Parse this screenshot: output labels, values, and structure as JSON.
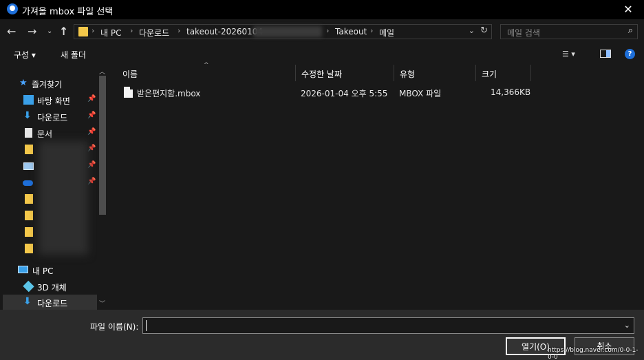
{
  "window": {
    "title": "가져올 mbox 파일 선택",
    "close_icon": "close-icon"
  },
  "nav": {
    "back_icon": "back-arrow-icon",
    "forward_icon": "forward-arrow-icon",
    "recent_icon": "chevron-down-icon",
    "up_icon": "up-arrow-icon",
    "address": {
      "crumbs": [
        "내 PC",
        "다운로드",
        "takeout-20260104",
        "Takeout",
        "메일"
      ]
    },
    "search": {
      "placeholder": "메일 검색"
    }
  },
  "toolbar": {
    "organize_label": "구성 ▾",
    "new_folder_label": "새 폴더"
  },
  "sidebar": {
    "quick_access_label": "즐겨찾기",
    "items": [
      {
        "label": "바탕 화면",
        "icon": "desktop-icon",
        "pinned": true
      },
      {
        "label": "다운로드",
        "icon": "download-icon",
        "pinned": true
      },
      {
        "label": "문서",
        "icon": "document-icon",
        "pinned": true
      }
    ],
    "this_pc_label": "내 PC",
    "pc_items": [
      {
        "label": "3D 개체",
        "icon": "3d-objects-icon"
      },
      {
        "label": "다운로드",
        "icon": "download-icon",
        "selected": true
      }
    ]
  },
  "columns": {
    "name": "이름",
    "modified": "수정한 날짜",
    "type": "유형",
    "size": "크기"
  },
  "files": [
    {
      "name": "받은편지함.mbox",
      "modified": "2026-01-04 오후 5:55",
      "type": "MBOX 파일",
      "size": "14,366KB"
    }
  ],
  "footer": {
    "filename_label": "파일 이름(N):",
    "filename_value": "",
    "open_label": "열기(O)",
    "cancel_label": "취소",
    "watermark": "https://blog.naver.com/0-0-1-0-0"
  },
  "colors": {
    "background": "#191919",
    "titlebar": "#000000",
    "footer": "#2b2b2b",
    "accent": "#1e6fd9",
    "folder": "#f4c84a"
  }
}
